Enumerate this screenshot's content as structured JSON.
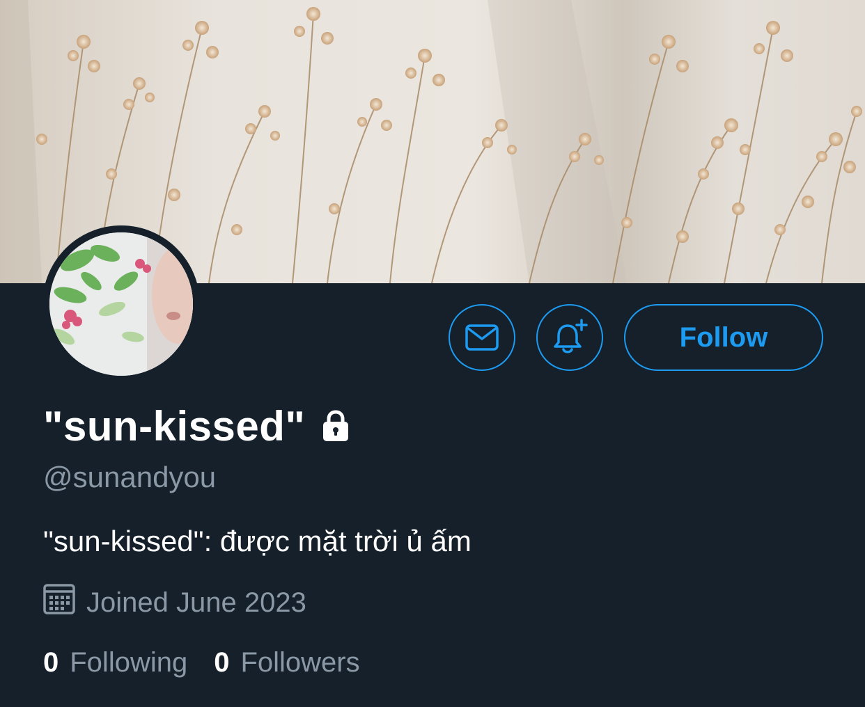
{
  "profile": {
    "display_name": "\"sun-kissed\"",
    "handle": "@sunandyou",
    "bio": "\"sun-kissed\": được mặt trời ủ ấm",
    "joined": "Joined June 2023",
    "following_count": "0",
    "following_label": "Following",
    "followers_count": "0",
    "followers_label": "Followers",
    "protected": true
  },
  "actions": {
    "message_icon": "envelope-icon",
    "notify_icon": "bell-plus-icon",
    "follow_label": "Follow"
  },
  "colors": {
    "background": "#15202b",
    "accent": "#1d9bf0",
    "text_primary": "#ffffff",
    "text_secondary": "#8b98a5"
  }
}
